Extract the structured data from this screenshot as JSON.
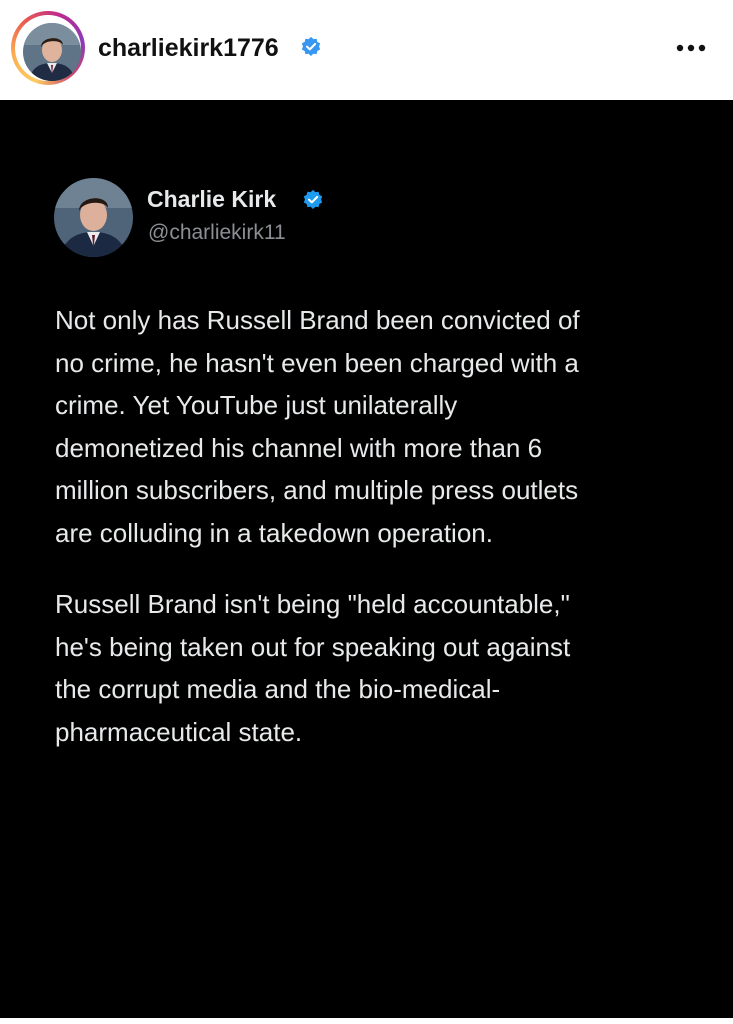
{
  "header": {
    "username": "charliekirk1776",
    "verified_icon": "verified-badge-icon",
    "more_icon": "more-options-icon",
    "verified_color": "#3897f0"
  },
  "tweet": {
    "display_name": "Charlie Kirk",
    "handle": "@charliekirk11",
    "verified_color": "#1d9bf0",
    "paragraph1_lines": [
      "Not only has Russell Brand been convicted of",
      "no crime, he hasn't even been charged with a",
      "crime. Yet YouTube just unilaterally",
      "demonetized his channel with more than 6",
      "million subscribers, and multiple press outlets",
      "are colluding in a takedown operation."
    ],
    "paragraph2_lines": [
      "Russell Brand isn't being \"held accountable,\"",
      "he's being taken out for speaking out against",
      "the corrupt media and the bio-medical-",
      "pharmaceutical state."
    ]
  }
}
